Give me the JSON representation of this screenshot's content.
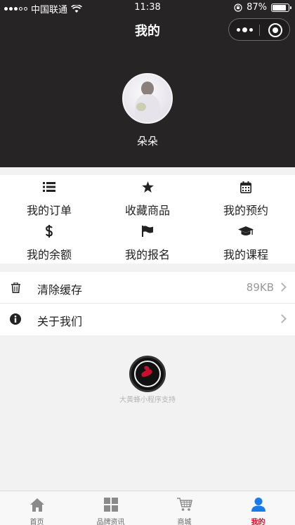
{
  "status_bar": {
    "carrier": "中国联通",
    "time": "11:38",
    "battery_text": "87%",
    "battery_level": 0.87
  },
  "nav": {
    "title": "我的"
  },
  "profile": {
    "name": "朵朵"
  },
  "grid": [
    {
      "label": "我的订单",
      "icon": "list-icon"
    },
    {
      "label": "收藏商品",
      "icon": "star-icon"
    },
    {
      "label": "我的预约",
      "icon": "calendar-icon"
    },
    {
      "label": "我的余额",
      "icon": "dollar-icon"
    },
    {
      "label": "我的报名",
      "icon": "flag-icon"
    },
    {
      "label": "我的课程",
      "icon": "graduation-cap-icon"
    }
  ],
  "list": [
    {
      "label": "清除缓存",
      "value": "89KB",
      "icon": "trash-icon"
    },
    {
      "label": "关于我们",
      "value": "",
      "icon": "info-icon"
    }
  ],
  "support_text": "大黄蜂小程序支持",
  "tabbar": [
    {
      "label": "首页",
      "icon": "home-icon"
    },
    {
      "label": "品牌资讯",
      "icon": "grid-icon"
    },
    {
      "label": "商城",
      "icon": "cart-icon"
    },
    {
      "label": "我的",
      "icon": "user-icon",
      "active": true
    }
  ],
  "colors": {
    "header_bg": "#262425",
    "accent": "#d7102b",
    "active_tab_icon": "#1a7ae6"
  }
}
